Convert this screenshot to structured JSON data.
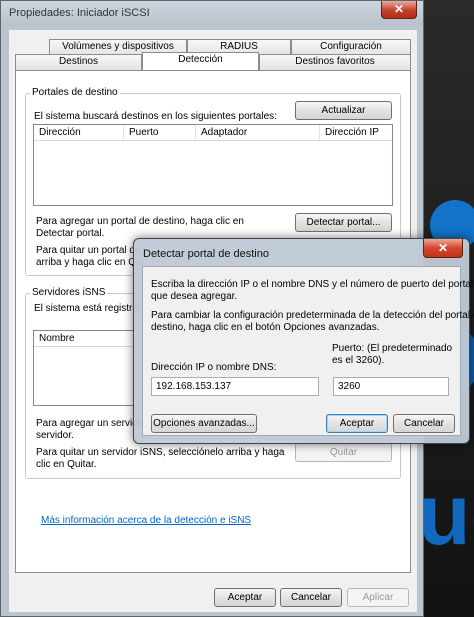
{
  "window": {
    "title": "Propiedades: Iniciador iSCSI",
    "close_glyph": "✕"
  },
  "tabs_back": [
    "Volúmenes y dispositivos",
    "RADIUS",
    "Configuración"
  ],
  "tabs_front": [
    "Destinos",
    "Detección",
    "Destinos favoritos"
  ],
  "portals": {
    "group_title": "Portales de destino",
    "description": "El sistema buscará destinos en los siguientes portales:",
    "refresh_button": "Actualizar",
    "columns": [
      "Dirección",
      "Puerto",
      "Adaptador",
      "Dirección IP"
    ],
    "add_text_1": "Para agregar un portal de destino, haga clic en",
    "add_text_2": "Detectar portal.",
    "discover_button": "Detectar portal...",
    "remove_text_1": "Para quitar un portal de",
    "remove_text_2": "arriba y haga clic en Qui"
  },
  "isns": {
    "group_title": "Servidores iSNS",
    "description": "El sistema está registrado",
    "columns": [
      "Nombre"
    ],
    "add_text_1": "Para agregar un servidor",
    "add_text_2": "servidor.",
    "remove_text_1": "Para quitar un servidor iSNS, selecciónelo arriba y haga",
    "remove_text_2": "clic en Quitar.",
    "remove_button": "Quitar"
  },
  "more_info_link": "Más información acerca de la detección e iSNS",
  "footer": {
    "ok": "Aceptar",
    "cancel": "Cancelar",
    "apply": "Aplicar"
  },
  "dialog": {
    "title": "Detectar portal de destino",
    "close_glyph": "✕",
    "intro_1": "Escriba la dirección IP o el nombre DNS y el número de puerto del portal",
    "intro_2": "que desea agregar.",
    "change_1": "Para cambiar la configuración predeterminada de la detección del portal de",
    "change_2": "destino, haga clic en el botón Opciones avanzadas.",
    "ip_label": "Dirección IP o nombre DNS:",
    "port_label_1": "Puerto: (El predeterminado",
    "port_label_2": "es el 3260).",
    "ip_value": "192.168.153.137",
    "port_value": "3260",
    "advanced_button": "Opciones avanzadas...",
    "ok": "Aceptar",
    "cancel": "Cancelar"
  },
  "background_text": "uc"
}
